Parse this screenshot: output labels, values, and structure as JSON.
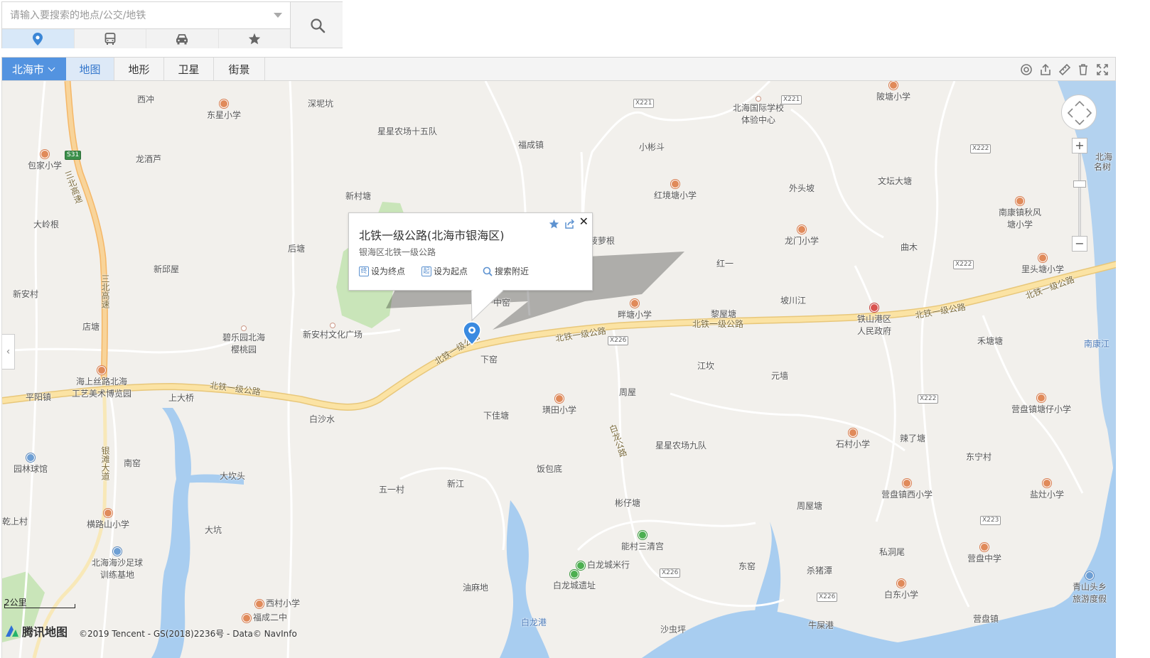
{
  "search": {
    "placeholder": "请输入要搜索的地点/公交/地铁",
    "modes": [
      {
        "name": "location-icon",
        "active": true
      },
      {
        "name": "bus-icon",
        "active": false
      },
      {
        "name": "car-icon",
        "active": false
      },
      {
        "name": "star-icon",
        "active": false
      }
    ]
  },
  "toolbar": {
    "city": "北海市",
    "layers": [
      "地图",
      "地形",
      "卫星",
      "街景"
    ],
    "active_layer": "地图",
    "tools": [
      "ranging-icon",
      "share-icon",
      "ruler-icon",
      "clear-icon",
      "fullscreen-icon"
    ]
  },
  "popup": {
    "title": "北铁一级公路(北海市银海区)",
    "address": "银海区北铁一级公路",
    "actions": [
      {
        "badge": "终",
        "label": "设为终点"
      },
      {
        "badge": "起",
        "label": "设为起点"
      },
      {
        "badge": "search",
        "label": "搜索附近"
      }
    ]
  },
  "map": {
    "place_labels": [
      "西冲",
      "东星小学",
      "深坭坑",
      "星星农场十五队",
      "福成镇",
      "小彬斗",
      "北海国际学校",
      "体验中心",
      "陂塘小学",
      "包家小学",
      "龙酒芦",
      "新村塘",
      "红境塘小学",
      "外头坡",
      "文坛大塘",
      "北海",
      "名树",
      "大岭根",
      "后塘",
      "菠萝根",
      "龙门小学",
      "曲木",
      "南康镇秋风",
      "塘小学",
      "新邱屋",
      "红一",
      "里头塘小学",
      "新安村",
      "中窑",
      "畔塘小学",
      "黎屋塘",
      "坡川江",
      "铁山港区",
      "人民政府",
      "店塘",
      "碧乐园北海",
      "樱桃园",
      "新安村文化广场",
      "下窑",
      "禾塘塘",
      "南康江",
      "江坎",
      "元墙",
      "海上丝路北海",
      "工艺美术博览园",
      "平阳镇",
      "上大桥",
      "白沙水",
      "周屋",
      "下佳塘",
      "璜田小学",
      "营盘镇塘仔小学",
      "辣了塘",
      "石村小学",
      "东宁村",
      "星星农场九队",
      "园林球馆",
      "南窑",
      "大坎头",
      "饭包底",
      "新江",
      "五一村",
      "营盘镇西小学",
      "盐灶小学",
      "乾上村",
      "横路山小学",
      "大坑",
      "彬仔塘",
      "周屋塘",
      "北海海沙足球",
      "训练基地",
      "能村三清宫",
      "白龙城米行",
      "白龙城遗址",
      "东窑",
      "杀猪潭",
      "私洞尾",
      "营盘中学",
      "青山头乡",
      "旅游度假",
      "油麻地",
      "白东小学",
      "西村小学",
      "白龙港",
      "沙虫坪",
      "牛屎港",
      "营盘镇",
      "福成二中"
    ],
    "road_labels": [
      "北铁一级公路",
      "北铁一级公路",
      "北铁一级公路",
      "北铁一级公路",
      "北铁一级公路",
      "北铁一级公路",
      "北铁一级公路",
      "三北高速",
      "三北高速",
      "白龙公路",
      "银滩大道",
      "南康江"
    ],
    "shields": [
      "S31",
      "X221",
      "X221",
      "X222",
      "X222",
      "X222",
      "X226",
      "X222",
      "X223",
      "X226",
      "X226"
    ],
    "scale": "2公里",
    "logo": "腾讯地图",
    "copyright": "©2019 Tencent - GS(2018)2236号 - Data© NavInfo"
  }
}
